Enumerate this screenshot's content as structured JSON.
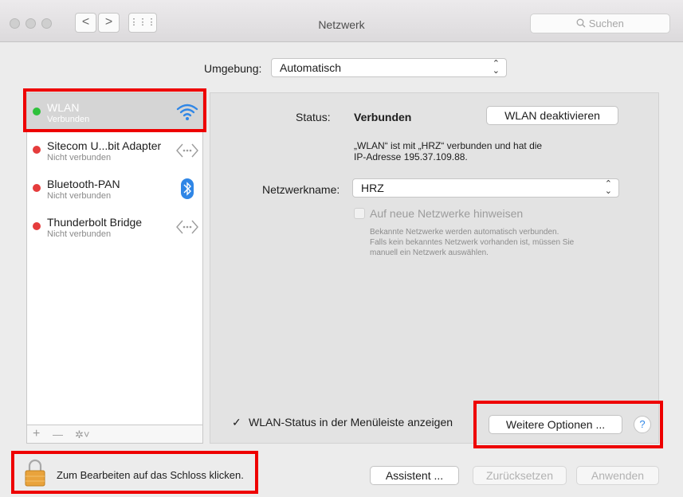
{
  "window": {
    "title": "Netzwerk",
    "search_placeholder": "Suchen",
    "nav_back": "<",
    "nav_forward": ">",
    "grid": "⋮⋮⋮"
  },
  "location": {
    "label": "Umgebung:",
    "value": "Automatisch"
  },
  "services": [
    {
      "name": "WLAN",
      "status": "Verbunden",
      "color": "#2ec13b",
      "icon": "wifi-icon",
      "selected": true
    },
    {
      "name": "Sitecom U...bit Adapter",
      "status": "Nicht verbunden",
      "color": "#e53c3c",
      "icon": "ethernet-arrows-icon"
    },
    {
      "name": "Bluetooth-PAN",
      "status": "Nicht verbunden",
      "color": "#e53c3c",
      "icon": "bluetooth-icon"
    },
    {
      "name": "Thunderbolt Bridge",
      "status": "Nicht verbunden",
      "color": "#e53c3c",
      "icon": "ethernet-arrows-icon"
    }
  ],
  "sidebar_toolbar": {
    "add": "+",
    "remove": "—",
    "gear": "✲˅"
  },
  "detail": {
    "status_label": "Status:",
    "status_value": "Verbunden",
    "toggle_button": "WLAN deaktivieren",
    "info_line1": "„WLAN“ ist mit „HRZ“ verbunden und hat die",
    "info_line2": "IP-Adresse 195.37.109.88.",
    "network_label": "Netzwerkname:",
    "network_value": "HRZ",
    "ask_join_label": "Auf neue Netzwerke hinweisen",
    "ask_join_desc1": "Bekannte Netzwerke werden automatisch verbunden.",
    "ask_join_desc2": "Falls kein bekanntes Netzwerk vorhanden ist, müssen Sie",
    "ask_join_desc3": "manuell ein Netzwerk auswählen.",
    "menubar_label": "WLAN-Status in der Menüleiste anzeigen",
    "advanced_button": "Weitere Optionen ...",
    "help": "?"
  },
  "footer": {
    "lock_text": "Zum Bearbeiten auf das Schloss klicken.",
    "assist_button": "Assistent ...",
    "revert_button": "Zurücksetzen",
    "apply_button": "Anwenden"
  },
  "highlight_color": "#ee0000"
}
